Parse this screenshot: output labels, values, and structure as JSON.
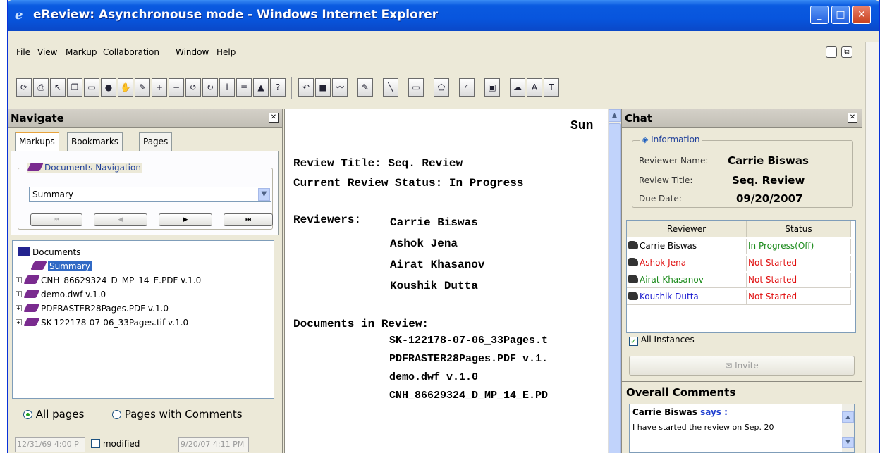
{
  "window": {
    "title": "eReview: Asynchronouse mode - Windows Internet Explorer"
  },
  "menu": [
    "File",
    "View",
    "Markup",
    "Collaboration",
    "Window",
    "Help"
  ],
  "navigate": {
    "title": "Navigate",
    "tabs": [
      "Markups",
      "Bookmarks",
      "Pages"
    ],
    "group_legend": "Documents Navigation",
    "select_value": "Summary",
    "tree": {
      "root": "Documents",
      "items": [
        "Summary",
        "CNH_86629324_D_MP_14_E.PDF v.1.0",
        "demo.dwf v.1.0",
        "PDFRASTER28Pages.PDF v.1.0",
        "SK-122178-07-06_33Pages.tif v.1.0"
      ]
    },
    "radio_all": "All pages",
    "radio_comments": "Pages with Comments",
    "date_from": "12/31/69 4:00 P",
    "modified_label": "modified",
    "date_to": "9/20/07 4:11 PM"
  },
  "summary": {
    "heading": "Sun",
    "review_title": "Review Title: Seq. Review",
    "status": "Current Review Status: In Progress",
    "reviewers_label": "Reviewers:",
    "reviewers": [
      "Carrie Biswas",
      "Ashok Jena",
      "Airat Khasanov",
      "Koushik Dutta"
    ],
    "docs_label": "Documents in Review:",
    "docs": [
      "SK-122178-07-06_33Pages.t",
      "PDFRASTER28Pages.PDF v.1.",
      "demo.dwf v.1.0",
      "CNH_86629324_D_MP_14_E.PD"
    ]
  },
  "chat": {
    "title": "Chat",
    "info_legend": "Information",
    "reviewer_name_label": "Reviewer Name:",
    "reviewer_name": "Carrie Biswas",
    "review_title_label": "Review Title:",
    "review_title": "Seq. Review",
    "due_label": "Due Date:",
    "due_date": "09/20/2007",
    "col_reviewer": "Reviewer",
    "col_status": "Status",
    "rows": [
      {
        "name": "Carrie Biswas",
        "status": "In Progress(Off)",
        "name_color": "#000000",
        "status_color": "#1a8a1a"
      },
      {
        "name": "Ashok Jena",
        "status": "Not Started",
        "name_color": "#e01010",
        "status_color": "#e01010"
      },
      {
        "name": "Airat Khasanov",
        "status": "Not Started",
        "name_color": "#1a8a1a",
        "status_color": "#e01010"
      },
      {
        "name": "Koushik Dutta",
        "status": "Not Started",
        "name_color": "#1a1ad0",
        "status_color": "#e01010"
      }
    ],
    "all_instances": "All Instances",
    "invite": "Invite",
    "overall_title": "Overall Comments",
    "comment_author": "Carrie Biswas",
    "comment_says": "says :",
    "comment_text": "I have started the review on Sep. 20"
  }
}
